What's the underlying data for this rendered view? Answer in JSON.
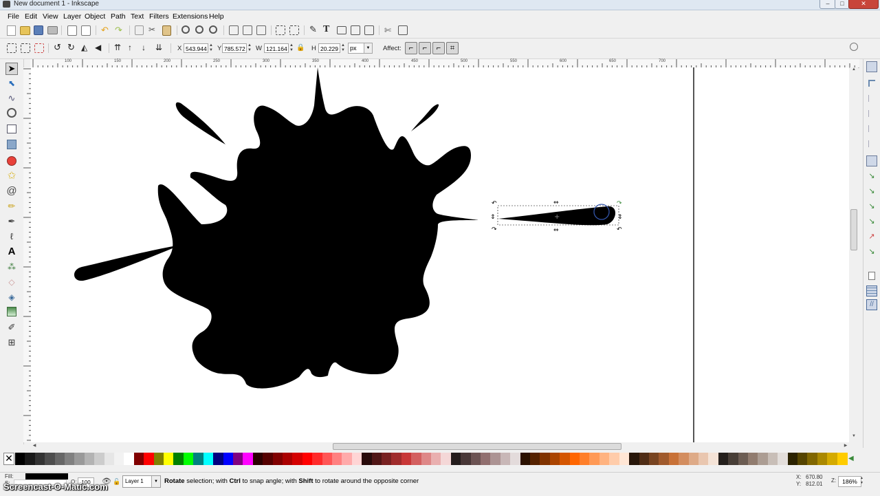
{
  "window": {
    "title": "New document 1 - Inkscape",
    "buttons": {
      "minimize": "–",
      "maximize": "□",
      "close": "✕"
    }
  },
  "menubar": {
    "items": [
      "File",
      "Edit",
      "View",
      "Layer",
      "Object",
      "Path",
      "Text",
      "Filters",
      "Extensions",
      "Help"
    ]
  },
  "select_toolbar": {
    "x_label": "X",
    "x_value": "543.944",
    "y_label": "Y",
    "y_value": "785.572",
    "w_label": "W",
    "w_value": "121.164",
    "h_label": "H",
    "h_value": "20.229",
    "unit": "px",
    "affect_label": "Affect:"
  },
  "ruler": {
    "h_ticks": [
      "100",
      "150",
      "200",
      "250",
      "300",
      "350",
      "400",
      "450",
      "500",
      "550",
      "600",
      "650",
      "700"
    ]
  },
  "statusbar": {
    "fill_label": "Fill:",
    "stroke_label": "S:",
    "opacity_label": "O:",
    "opacity_value": "100",
    "layer": "Layer 1",
    "message_parts": {
      "p1": "Rotate",
      "p2": " selection; with ",
      "p3": "Ctrl",
      "p4": " to snap angle; with ",
      "p5": "Shift",
      "p6": " to rotate around the opposite corner"
    },
    "cursor_x_label": "X:",
    "cursor_x": "670.80",
    "cursor_y_label": "Y:",
    "cursor_y": "812.01",
    "zoom_label": "Z:",
    "zoom": "186%"
  },
  "watermark": "Screencast-O-Matic.com",
  "palette": {
    "colors": [
      "#000000",
      "#1a1a1a",
      "#333333",
      "#4d4d4d",
      "#666666",
      "#808080",
      "#999999",
      "#b3b3b3",
      "#cccccc",
      "#e6e6e6",
      "#f2f2f2",
      "#ffffff",
      "#800000",
      "#ff0000",
      "#808000",
      "#ffff00",
      "#008000",
      "#00ff00",
      "#008080",
      "#00ffff",
      "#000080",
      "#0000ff",
      "#800080",
      "#ff00ff",
      "#2b0000",
      "#550000",
      "#800000",
      "#aa0000",
      "#d40000",
      "#ff0000",
      "#ff2a2a",
      "#ff5555",
      "#ff8080",
      "#ffaaaa",
      "#ffd5d5",
      "#280b0b",
      "#501616",
      "#782121",
      "#a02c2c",
      "#c83737",
      "#d35f5f",
      "#de8787",
      "#e9afaf",
      "#f4d7d7",
      "#241c1c",
      "#483737",
      "#6c5353",
      "#916f6f",
      "#ac9393",
      "#c8b7b7",
      "#e3dbdb",
      "#2b1100",
      "#552200",
      "#803300",
      "#aa4400",
      "#d45500",
      "#ff6600",
      "#ff7f2a",
      "#ff9955",
      "#ffb380",
      "#ffccaa",
      "#ffe6d5",
      "#28170b",
      "#502d16",
      "#784421",
      "#a05a2c",
      "#c87137",
      "#d38d5f",
      "#deaa87",
      "#e9c6af",
      "#f4e3d7",
      "#241f1c",
      "#483e37",
      "#6c5d53",
      "#917c6f",
      "#ac9d93",
      "#c8beb7",
      "#e3dedb",
      "#2b2200",
      "#554400",
      "#806600",
      "#aa8800",
      "#d4aa00",
      "#ffcc00"
    ]
  }
}
